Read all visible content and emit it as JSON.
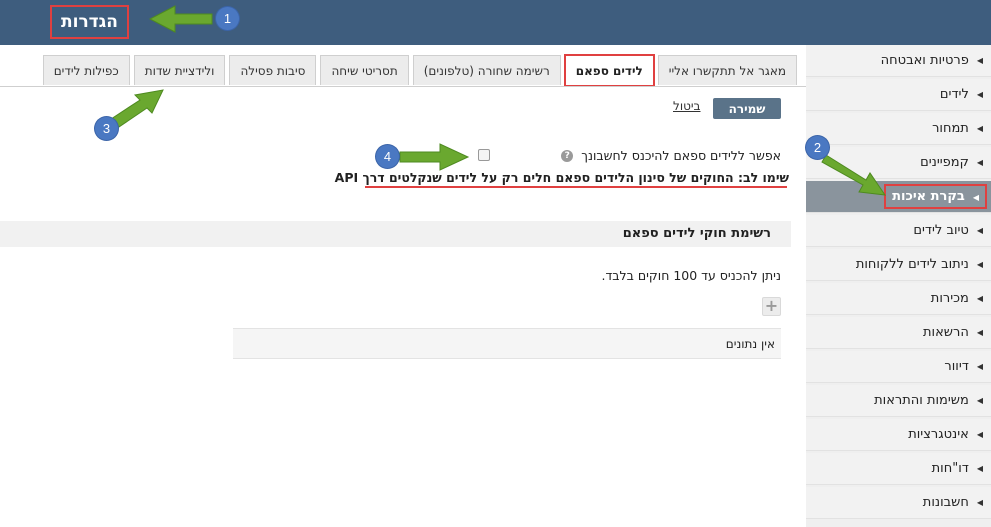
{
  "header": {
    "title": "הגדרות"
  },
  "sidebar": {
    "items": [
      {
        "label": "פרטיות ואבטחה"
      },
      {
        "label": "לידים"
      },
      {
        "label": "תמחור"
      },
      {
        "label": "קמפיינים"
      },
      {
        "label": "בקרת איכות",
        "active": true
      },
      {
        "label": "טיוב לידים"
      },
      {
        "label": "ניתוב לידים ללקוחות"
      },
      {
        "label": "מכירות"
      },
      {
        "label": "הרשאות"
      },
      {
        "label": "דיוור"
      },
      {
        "label": "משימות והתראות"
      },
      {
        "label": "אינטגרציות"
      },
      {
        "label": "דו\"חות"
      },
      {
        "label": "חשבונות"
      }
    ]
  },
  "tabs": [
    {
      "label": "כפילות לידים"
    },
    {
      "label": "ולידציית שדות"
    },
    {
      "label": "סיבות פסילה"
    },
    {
      "label": "תסריטי שיחה"
    },
    {
      "label": "רשימה שחורה (טלפונים)"
    },
    {
      "label": "לידים ספאם",
      "active": true
    },
    {
      "label": "מאגר אל תתקשרו אליי"
    }
  ],
  "actions": {
    "save_label": "שמירה",
    "cancel_label": "ביטול"
  },
  "spam": {
    "allow_label": "אפשר ללידים ספאם להיכנס לחשבונך",
    "note": "שימו לב: החוקים של סינון הלידים ספאם חלים רק על לידים שנקלטים דרך API",
    "section_title": "רשימת חוקי לידים ספאם",
    "info": "ניתן להכניס עד 100 חוקים בלבד.",
    "empty": "אין נתונים"
  },
  "annotations": {
    "b1": "1",
    "b2": "2",
    "b3": "3",
    "b4": "4"
  },
  "colors": {
    "header": "#3e5d7e",
    "highlight": "#e04040",
    "arrow": "#6aa82f",
    "badge": "#4a78c2"
  }
}
